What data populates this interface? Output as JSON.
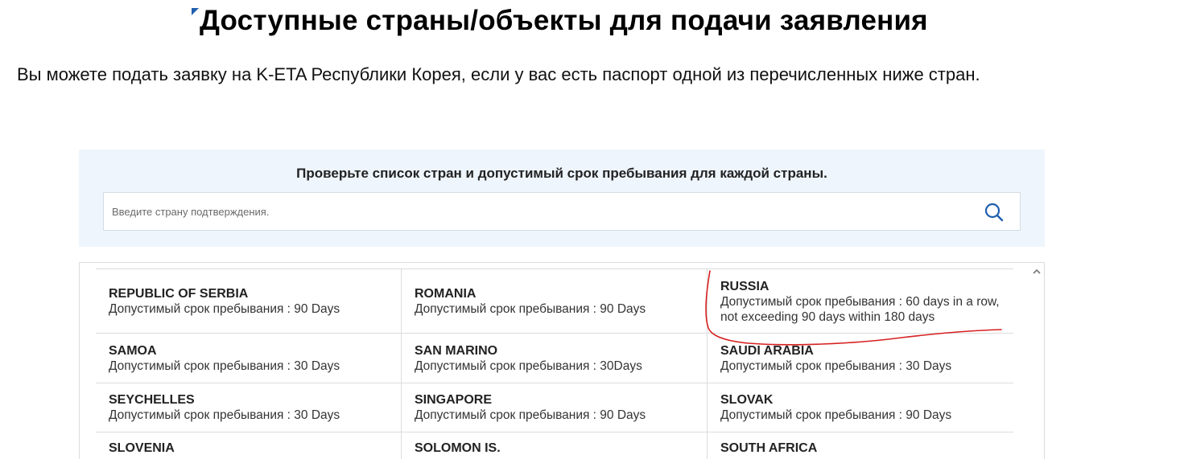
{
  "page": {
    "title": "Доступные страны/объекты для подачи заявления",
    "intro": "Вы можете подать заявку на K-ETA Республики Корея, если у вас есть паспорт одной из перечисленных ниже стран."
  },
  "search": {
    "heading": "Проверьте список стран и допустимый срок пребывания для каждой страны.",
    "placeholder": "Введите страну подтверждения.",
    "icon": "search-icon"
  },
  "countries": [
    {
      "name": "REPUBLIC OF SERBIA",
      "stay": "Допустимый срок пребывания : 90 Days"
    },
    {
      "name": "ROMANIA",
      "stay": "Допустимый срок пребывания : 90 Days"
    },
    {
      "name": "RUSSIA",
      "stay": "Допустимый срок пребывания : 60 days in a row, not exceeding 90 days within 180 days"
    },
    {
      "name": "SAMOA",
      "stay": "Допустимый срок пребывания : 30 Days"
    },
    {
      "name": "SAN MARINO",
      "stay": "Допустимый срок пребывания : 30Days"
    },
    {
      "name": "SAUDI ARABIA",
      "stay": "Допустимый срок пребывания : 30 Days"
    },
    {
      "name": "SEYCHELLES",
      "stay": "Допустимый срок пребывания : 30 Days"
    },
    {
      "name": "SINGAPORE",
      "stay": "Допустимый срок пребывания : 90 Days"
    },
    {
      "name": "SLOVAK",
      "stay": "Допустимый срок пребывания : 90 Days"
    },
    {
      "name": "SLOVENIA",
      "stay": ""
    },
    {
      "name": "SOLOMON IS.",
      "stay": ""
    },
    {
      "name": "SOUTH AFRICA",
      "stay": ""
    }
  ],
  "colors": {
    "panel_background": "#eef5fd",
    "search_icon": "#1f5fae",
    "annotation_ink": "#d62020",
    "grid_line": "#dcdcdc"
  }
}
